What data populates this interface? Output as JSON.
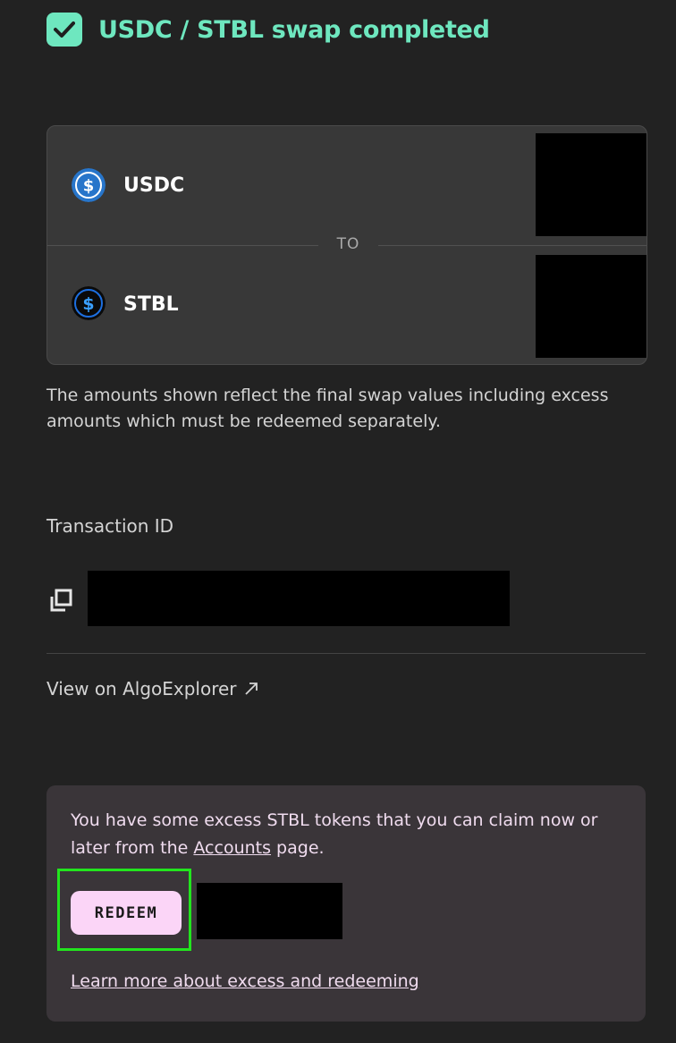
{
  "header": {
    "title": "USDC / STBL swap completed",
    "icon": "checkmark-icon"
  },
  "swap": {
    "from_token": {
      "symbol": "USDC",
      "icon": "usdc-coin-icon"
    },
    "to_label": "TO",
    "to_token": {
      "symbol": "STBL",
      "icon": "stbl-coin-icon"
    }
  },
  "note": "The amounts shown reflect the final swap values including excess amounts which must be redeemed separately.",
  "transaction": {
    "label": "Transaction ID",
    "copy_icon": "copy-icon",
    "explorer_link": "View on AlgoExplorer",
    "explorer_icon": "external-arrow-icon"
  },
  "excess": {
    "text_before": "You have some excess STBL tokens that you can claim now or later from the ",
    "accounts_link": "Accounts",
    "text_after": " page.",
    "redeem_label": "REDEEM",
    "learn_more": "Learn more about excess and redeeming"
  },
  "colors": {
    "accent": "#6ee7bf",
    "background": "#222222",
    "card": "#383838",
    "panel": "#3a3539",
    "redeem": "#fbd5f7",
    "highlight": "#22e51e"
  }
}
